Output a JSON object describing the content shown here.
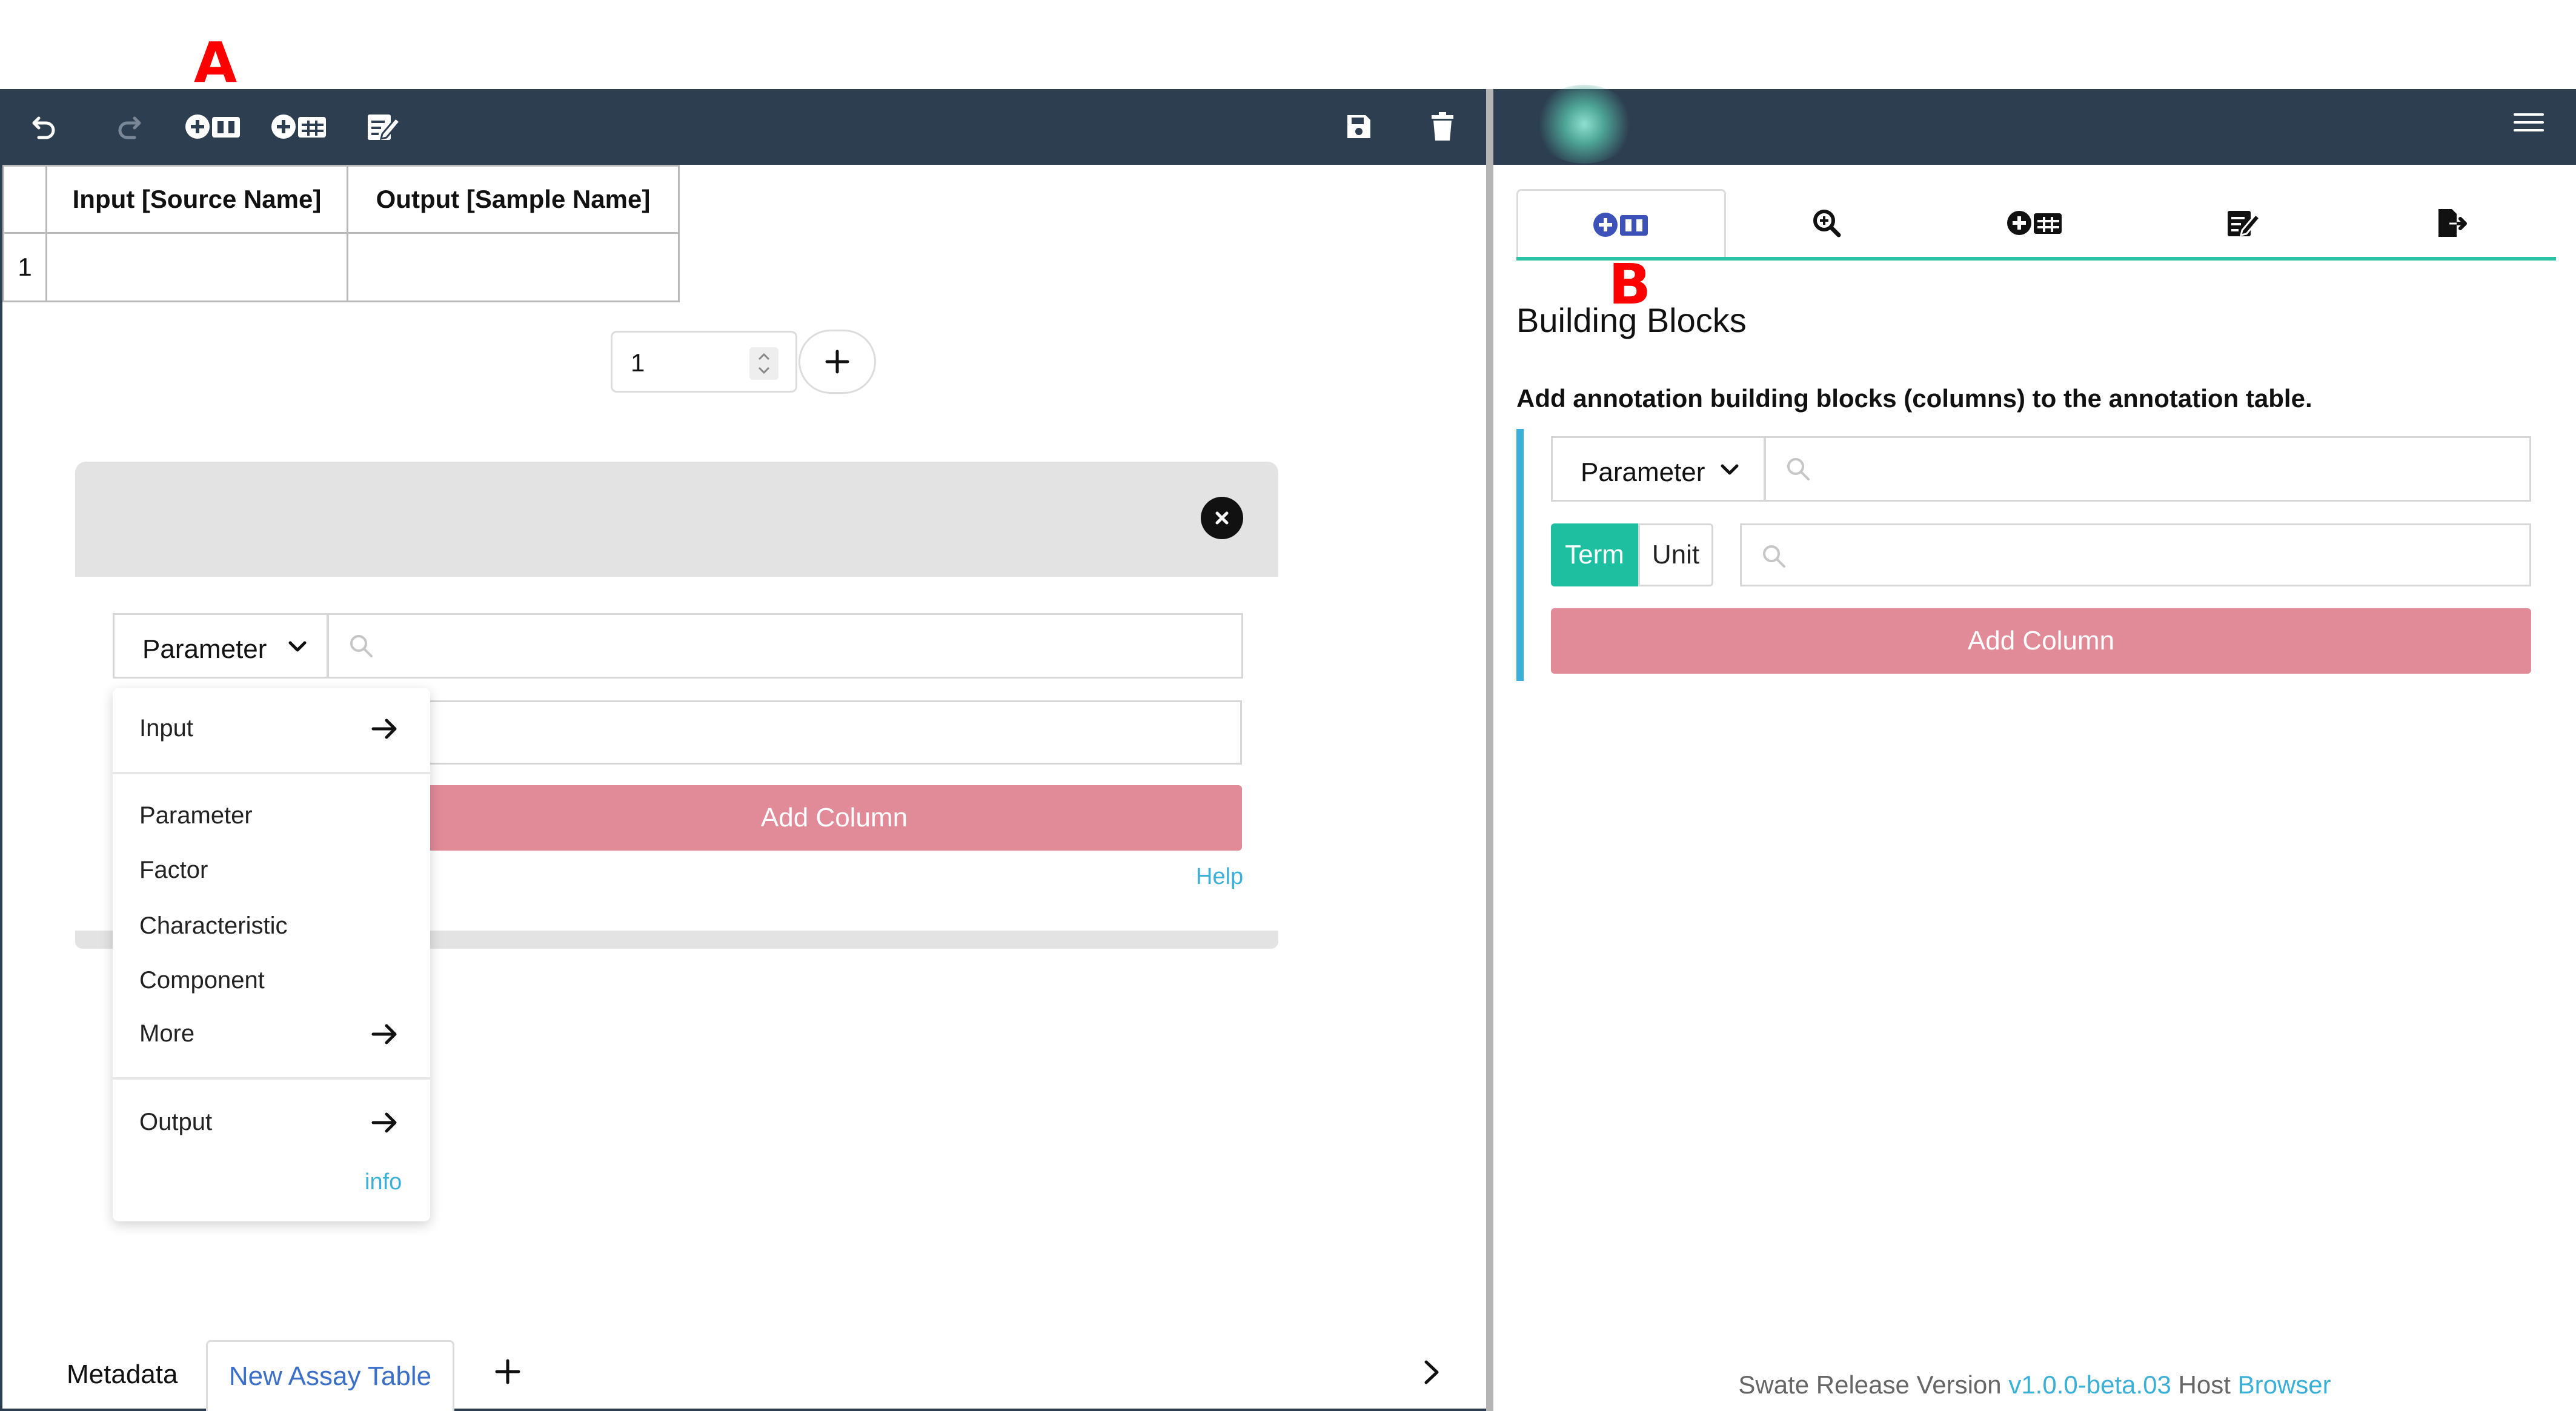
{
  "markers": {
    "a": "A",
    "b": "B"
  },
  "table": {
    "columns": [
      "Input [Source Name]",
      "Output [Sample Name]"
    ],
    "rows": [
      {
        "index": "1",
        "cells": [
          "",
          ""
        ]
      }
    ]
  },
  "row_count_input": {
    "value": "1"
  },
  "left_builder": {
    "type_select": "Parameter",
    "add_column_label": "Add Column",
    "help_label": "Help"
  },
  "dropdown": {
    "input_label": "Input",
    "items": [
      "Parameter",
      "Factor",
      "Characteristic",
      "Component"
    ],
    "more_label": "More",
    "output_label": "Output",
    "info_label": "info"
  },
  "bottom_tabs": {
    "metadata": "Metadata",
    "assay_table": "New Assay Table"
  },
  "right_panel": {
    "title": "Building Blocks",
    "description": "Add annotation building blocks (columns) to the annotation table.",
    "type_select": "Parameter",
    "term_label": "Term",
    "unit_label": "Unit",
    "add_column_label": "Add Column"
  },
  "footer": {
    "prefix": "Swate Release Version",
    "version": "v1.0.0-beta.03",
    "host_label": "Host",
    "host_value": "Browser"
  },
  "colors": {
    "toolbar": "#2d3e50",
    "accent_teal": "#1ebfa0",
    "add_column": "#e18a98",
    "link": "#3ab0d8",
    "marker": "#ff0000"
  },
  "icons": {
    "toolbar": [
      "undo-icon",
      "redo-icon",
      "add-building-block-icon",
      "add-template-icon",
      "edit-table-icon",
      "save-icon",
      "trash-icon"
    ],
    "right_tabs": [
      "add-building-block-icon",
      "search-term-icon",
      "add-template-icon",
      "file-picker-icon",
      "export-icon"
    ]
  }
}
